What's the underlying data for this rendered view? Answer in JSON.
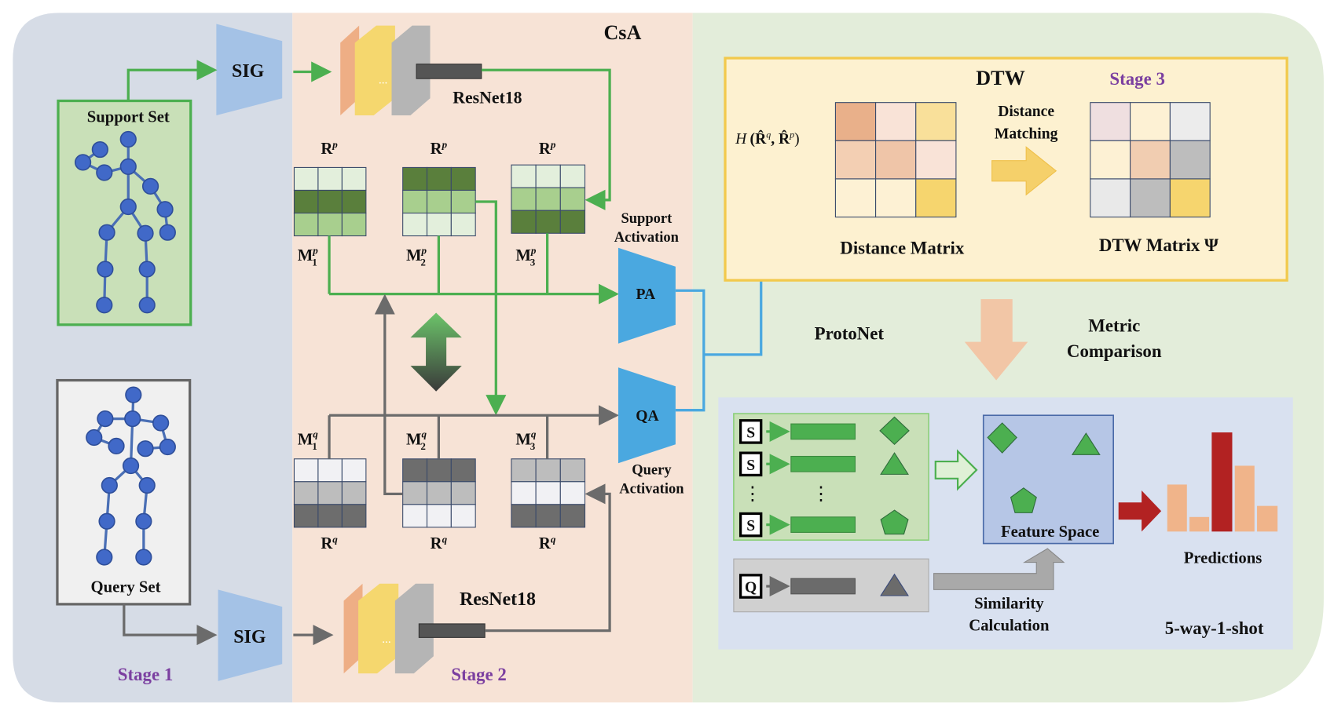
{
  "stage1": {
    "label": "Stage 1",
    "support_set": "Support Set",
    "query_set": "Query Set",
    "sig_top": "SIG",
    "sig_bottom": "SIG"
  },
  "stage2": {
    "label": "Stage 2",
    "title": "CsA",
    "resnet_top": "ResNet18",
    "resnet_bottom": "ResNet18",
    "layer_dots": "...",
    "support_matrix": {
      "base": "R",
      "sup": "p"
    },
    "query_matrix": {
      "base": "R",
      "sup": "q"
    },
    "support_masks": [
      {
        "base": "M",
        "sub": "1",
        "sup": "p"
      },
      {
        "base": "M",
        "sub": "2",
        "sup": "p"
      },
      {
        "base": "M",
        "sub": "3",
        "sup": "p"
      }
    ],
    "query_masks": [
      {
        "base": "M",
        "sub": "1",
        "sup": "q"
      },
      {
        "base": "M",
        "sub": "2",
        "sup": "q"
      },
      {
        "base": "M",
        "sub": "3",
        "sup": "q"
      }
    ],
    "pa": "PA",
    "qa": "QA",
    "support_activation": [
      "Support",
      "Activation"
    ],
    "query_activation": [
      "Query",
      "Activation"
    ]
  },
  "stage3": {
    "label": "Stage 3",
    "dtw_title": "DTW",
    "h_label": {
      "fn": "H",
      "args": "(R̂",
      "q": "q",
      "mid": ", R̂",
      "p": "p",
      "end": ")"
    },
    "distance_matching": [
      "Distance",
      "Matching"
    ],
    "distance_matrix": "Distance Matrix",
    "dtw_matrix": "DTW Matrix Ψ",
    "protonet": "ProtoNet",
    "metric_comparison": [
      "Metric",
      "Comparison"
    ],
    "s_label": "S",
    "q_label": "Q",
    "feature_space": "Feature Space",
    "similarity_calculation": [
      "Similarity",
      "Calculation"
    ],
    "predictions": "Predictions",
    "setting": "5-way-1-shot"
  },
  "colors": {
    "stage1_bg": "#d6dce6",
    "stage2_bg": "#f7e3d6",
    "stage3_bg": "#e3edda",
    "support_green": "#4caf50",
    "query_gray": "#6b6b6b",
    "activation_blue": "#4aa8e0",
    "stage_purple": "#7b3fa0",
    "prediction_top": "#b22222"
  }
}
